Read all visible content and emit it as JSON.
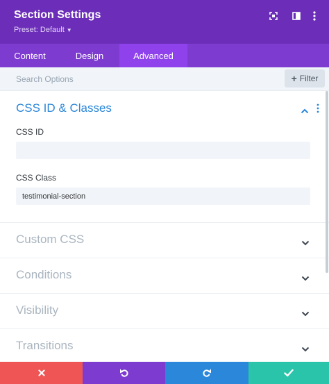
{
  "header": {
    "title": "Section Settings",
    "preset_label": "Preset: Default",
    "icons": [
      "expand-icon",
      "sidebar-icon",
      "more-vertical-icon"
    ]
  },
  "tabs": [
    {
      "label": "Content",
      "active": false
    },
    {
      "label": "Design",
      "active": false
    },
    {
      "label": "Advanced",
      "active": true
    }
  ],
  "search": {
    "placeholder": "Search Options",
    "value": "",
    "filter_label": "Filter"
  },
  "groups": {
    "css_id_classes": {
      "title": "CSS ID & Classes",
      "expanded": true,
      "css_id": {
        "label": "CSS ID",
        "value": ""
      },
      "css_class": {
        "label": "CSS Class",
        "value": "testimonial-section"
      }
    },
    "collapsed": [
      {
        "title": "Custom CSS"
      },
      {
        "title": "Conditions"
      },
      {
        "title": "Visibility"
      },
      {
        "title": "Transitions"
      }
    ]
  },
  "footer": {
    "buttons": [
      "close-icon",
      "undo-icon",
      "redo-icon",
      "check-icon"
    ]
  },
  "colors": {
    "header": "#6c2eb9",
    "tabs": "#7e3bd0",
    "tab_active": "#8f42ec",
    "accent_blue": "#2b87da",
    "close": "#ef5555",
    "undo": "#7d3bcf",
    "redo": "#2b87da",
    "save": "#29c4a9"
  }
}
